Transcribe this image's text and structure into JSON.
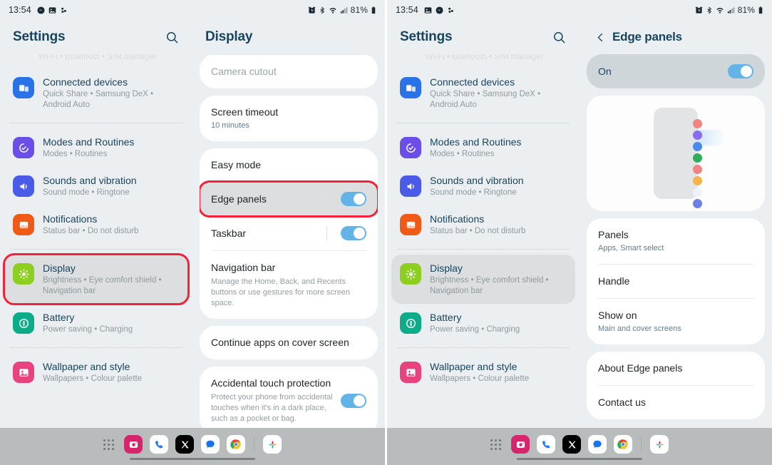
{
  "status_bar": {
    "time": "13:54",
    "battery": "81%",
    "left_icons": [
      "messenger-icon",
      "photos-icon",
      "slack-icon"
    ],
    "left_icons_right_screen": [
      "photos-icon",
      "messenger-icon",
      "slack-icon"
    ],
    "right_icons": [
      "alarm-icon",
      "bluetooth-icon",
      "wifi-icon",
      "signal-icon",
      "battery-icon"
    ]
  },
  "settings_pane": {
    "title": "Settings",
    "search_icon": "search-icon",
    "faded_row": "Wi-Fi  •  Bluetooth  •  SIM manager",
    "items": [
      {
        "title": "Connected devices",
        "sub": "Quick Share • Samsung DeX • Android Auto",
        "icon": "connected-devices-icon",
        "icon_color": "#2a72e8",
        "selected": false,
        "boxed": false
      },
      {
        "title": "Modes and Routines",
        "sub": "Modes • Routines",
        "icon": "modes-routines-icon",
        "icon_color": "#6b4de8",
        "selected": false,
        "boxed": false
      },
      {
        "title": "Sounds and vibration",
        "sub": "Sound mode • Ringtone",
        "icon": "sound-icon",
        "icon_color": "#4a5be8",
        "selected": false,
        "boxed": false
      },
      {
        "title": "Notifications",
        "sub": "Status bar • Do not disturb",
        "icon": "notifications-icon",
        "icon_color": "#ef5a17",
        "selected": false,
        "boxed": false
      },
      {
        "title": "Display",
        "sub": "Brightness • Eye comfort shield • Navigation bar",
        "icon": "display-icon",
        "icon_color": "#8ccf1f",
        "selected": true,
        "boxed": true
      },
      {
        "title": "Battery",
        "sub": "Power saving • Charging",
        "icon": "battery-icon",
        "icon_color": "#0cab8a",
        "selected": false,
        "boxed": false
      },
      {
        "title": "Wallpaper and style",
        "sub": "Wallpapers • Colour palette",
        "icon": "wallpaper-icon",
        "icon_color": "#e8437e",
        "selected": false,
        "boxed": false
      }
    ]
  },
  "display_pane": {
    "title": "Display",
    "cards": [
      {
        "items": [
          {
            "title": "Camera cutout",
            "muted": true,
            "hairline_above": true
          }
        ]
      },
      {
        "items": [
          {
            "title": "Screen timeout",
            "sub": "10 minutes"
          }
        ]
      },
      {
        "items": [
          {
            "title": "Easy mode"
          },
          {
            "title": "Edge panels",
            "toggle": true,
            "toggle_on": true,
            "highlighted": true,
            "boxed": true
          },
          {
            "title": "Taskbar",
            "toggle": true,
            "toggle_on": true
          },
          {
            "title": "Navigation bar",
            "desc": "Manage the Home, Back, and Recents buttons or use gestures for more screen space."
          }
        ]
      },
      {
        "items": [
          {
            "title": "Continue apps on cover screen"
          }
        ]
      },
      {
        "items": [
          {
            "title": "Accidental touch protection",
            "desc": "Protect your phone from accidental touches when it's in a dark place, such as a pocket or bag.",
            "toggle": true,
            "toggle_on": true
          }
        ]
      }
    ]
  },
  "edge_panels_pane": {
    "title": "Edge panels",
    "back_icon": "chevron-left-icon",
    "on_label": "On",
    "on_toggle": true,
    "illustration": {
      "name": "edge-panel-illustration",
      "dot_colors": [
        "#ef8480",
        "#8a6cf0",
        "#4a8ae8",
        "#2fae5a",
        "#ef8480",
        "#f8b24a",
        "#eef3fa",
        "#6b7fe8"
      ]
    },
    "cards": [
      {
        "items": [
          {
            "title": "Panels",
            "sub": "Apps, Smart select"
          },
          {
            "title": "Handle"
          },
          {
            "title": "Show on",
            "sub": "Main and cover screens"
          }
        ]
      },
      {
        "items": [
          {
            "title": "About Edge panels"
          },
          {
            "title": "Contact us"
          }
        ]
      }
    ]
  },
  "dock": {
    "apps_grid_icon": "app-grid-icon",
    "apps": [
      {
        "name": "instagram-icon",
        "color": "#d6256b"
      },
      {
        "name": "phone-icon",
        "color": "#1d7df2"
      },
      {
        "name": "x-icon",
        "color": "#000000"
      },
      {
        "name": "messages-icon",
        "color": "#1a73e8"
      },
      {
        "name": "chrome-icon",
        "color": "#4285f4"
      }
    ],
    "pinned": [
      {
        "name": "slack-icon",
        "color": "#e01e5a"
      }
    ]
  },
  "colors": {
    "accent_toggle": "#62b4e8",
    "highlight_box": "#f2223a",
    "page_bg": "#eceff1",
    "card_bg": "#ffffff",
    "title_blue": "#17455f"
  }
}
